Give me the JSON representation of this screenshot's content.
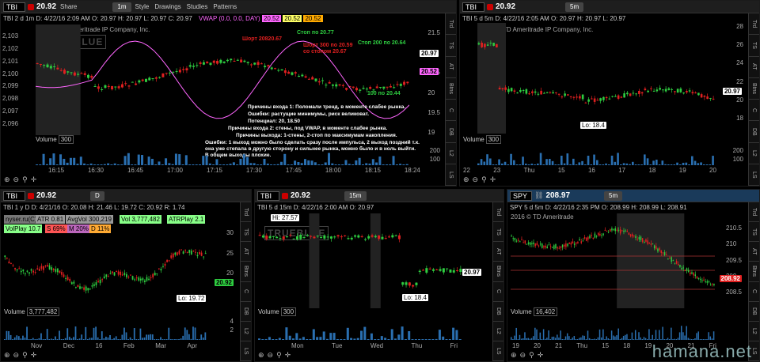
{
  "colors": {
    "up": "#2ecc40",
    "down": "#e02020",
    "vwap": "#ff66ff",
    "tag_price": "#2ecc40",
    "tag_vwap": "#ff66ff",
    "vol": "#2a6fb0"
  },
  "top_left": {
    "symbol": "TBI",
    "period": "TBI 2 d 1m",
    "price": "20.92",
    "share": "Share",
    "timeframe": "1m",
    "style": "Style",
    "drawings": "Drawings",
    "studies": "Studies",
    "patterns": "Patterns",
    "info": "TBI 2 d 1m  D: 4/22/16 2:09 AM  O: 20.97  H: 20.97  L: 20.97  C: 20.97",
    "vwap_label": "VWAP (0.0, 0.0, DAY)",
    "vwap_v1": "20.52",
    "vwap_v2": "20.52",
    "vwap_v3": "20.52",
    "copyright": "2016 © TD Ameritrade IP Company, Inc.",
    "watermark": "TRUEBLUE",
    "left_axis": [
      "2,103",
      "2,102",
      "2,101",
      "2,100",
      "2,099",
      "2,098",
      "2,097",
      "2,096"
    ],
    "right_axis": [
      "21.5",
      "21",
      "20.5",
      "20",
      "19.5",
      "19"
    ],
    "price_tag": "20.97",
    "vwap_tag": "20.52",
    "x_labels": [
      "16:15",
      "16:30",
      "16:45",
      "17:00",
      "17:15",
      "17:30",
      "17:45",
      "18:00",
      "18:15",
      "18:24"
    ],
    "volume_label": "Volume",
    "volume_value": "300",
    "vol_axis": [
      "200",
      "100"
    ],
    "annotations": [
      {
        "text": "Шорт 20820.67",
        "color": "#e02020"
      },
      {
        "text": "Стоп по 20.77",
        "color": "#2ecc40"
      },
      {
        "text": "Шорт 300 по 20.59",
        "color": "#e02020"
      },
      {
        "text": "со стопом 20.67",
        "color": "#e02020"
      },
      {
        "text": "Стоп 200 по 20.64",
        "color": "#2ecc40"
      },
      {
        "text": "100 по 20.44",
        "color": "#2ecc40"
      }
    ],
    "notes": [
      "Причины входа 1: Поломали тренд, в моменте слабее рынка.",
      "Ошибки: растущие минимумы, риск великоват.",
      "Потенциал: 20, 18.50",
      "Причины входа 2: стены, под VWAP, в моменте слабее рынка.",
      "Причины выхода: 1-стены, 2-стоп по максимумам накопления.",
      "Ошибки: 1 выход можно было сделать сразу после импульса, 2 выход поздний т.к.",
      "она уже степала в другую сторону и сильнее рынка, можно было и в ноль выйти.",
      "В общем выходы плохие."
    ]
  },
  "top_right": {
    "symbol": "TBI",
    "price": "20.92",
    "timeframe": "5m",
    "info": "TBI 5 d 5m  D: 4/22/16 2:05 AM  O: 20.97  H: 20.97  L: 20.97",
    "copyright": "2016 © TD Ameritrade IP Company, Inc.",
    "right_axis": [
      "28",
      "26",
      "24",
      "22",
      "20",
      "18"
    ],
    "price_tag": "20.97",
    "lo_tag": "Lo: 18.4",
    "x_labels": [
      "22",
      "23",
      "Thu",
      "15",
      "16",
      "17",
      "18",
      "19",
      "20"
    ],
    "volume_label": "Volume",
    "volume_value": "300",
    "vol_axis": [
      "200",
      "100"
    ]
  },
  "bottom_left": {
    "symbol": "TBI",
    "price": "20.92",
    "timeframe": "D",
    "info": "TBI 1 y D  D: 4/21/16  O: 20.08  H: 21.46  L: 19.72  C: 20.92  R: 1.74",
    "stats": [
      {
        "text": "nyser.ru(C)",
        "bg": "#777"
      },
      {
        "text": "ATR 0.81",
        "bg": "#999"
      },
      {
        "text": "AvgVol 300,219",
        "bg": "#999"
      },
      {
        "text": "Vol 3,777,482",
        "bg": "#8f8"
      },
      {
        "text": "ATRPlay 2.1",
        "bg": "#8f8"
      },
      {
        "text": "VolPlay 10.7",
        "bg": "#8f8"
      },
      {
        "text": "S 69%",
        "bg": "#f55"
      },
      {
        "text": "M 20%",
        "bg": "#b6b"
      },
      {
        "text": "D 11%",
        "bg": "#fa3"
      }
    ],
    "right_axis": [
      "30",
      "25",
      "20"
    ],
    "price_tag": "20.92",
    "lo_tag": "Lo: 19.72",
    "x_labels": [
      "Nov",
      "Dec",
      "16",
      "Feb",
      "Mar",
      "Apr"
    ],
    "volume_label": "Volume",
    "volume_value": "3,777,482",
    "vol_axis": [
      "4",
      "2"
    ]
  },
  "bottom_mid": {
    "symbol": "TBI",
    "price": "20.92",
    "timeframe": "15m",
    "info": "TBI 5 d 15m  D: 4/22/16 2:00 AM  O: 20.97",
    "hi_tag": "Hi: 27.57",
    "lo_tag": "Lo: 18.4",
    "price_tag": "20.97",
    "watermark": "TRUEBLUE",
    "x_labels": [
      "Mon",
      "Tue",
      "Wed",
      "Thu",
      "Fri"
    ],
    "volume_label": "Volume",
    "volume_value": "300"
  },
  "bottom_right": {
    "symbol": "SPY",
    "price": "208.97",
    "timeframe": "5m",
    "info": "SPY 5 d 5m  D: 4/22/16 2:35 PM  O: 208.99  H: 208.99  L: 208.91",
    "copyright": "2016 © TD Ameritrade",
    "right_axis": [
      "210.5",
      "210",
      "209.5",
      "209",
      "208.5"
    ],
    "price_tag": "208.92",
    "x_labels": [
      "19",
      "20",
      "21",
      "Thu",
      "15",
      "18",
      "19",
      "20",
      "21",
      "Fri"
    ],
    "volume_label": "Volume",
    "volume_value": "16,402"
  },
  "footer": "hamana.net"
}
